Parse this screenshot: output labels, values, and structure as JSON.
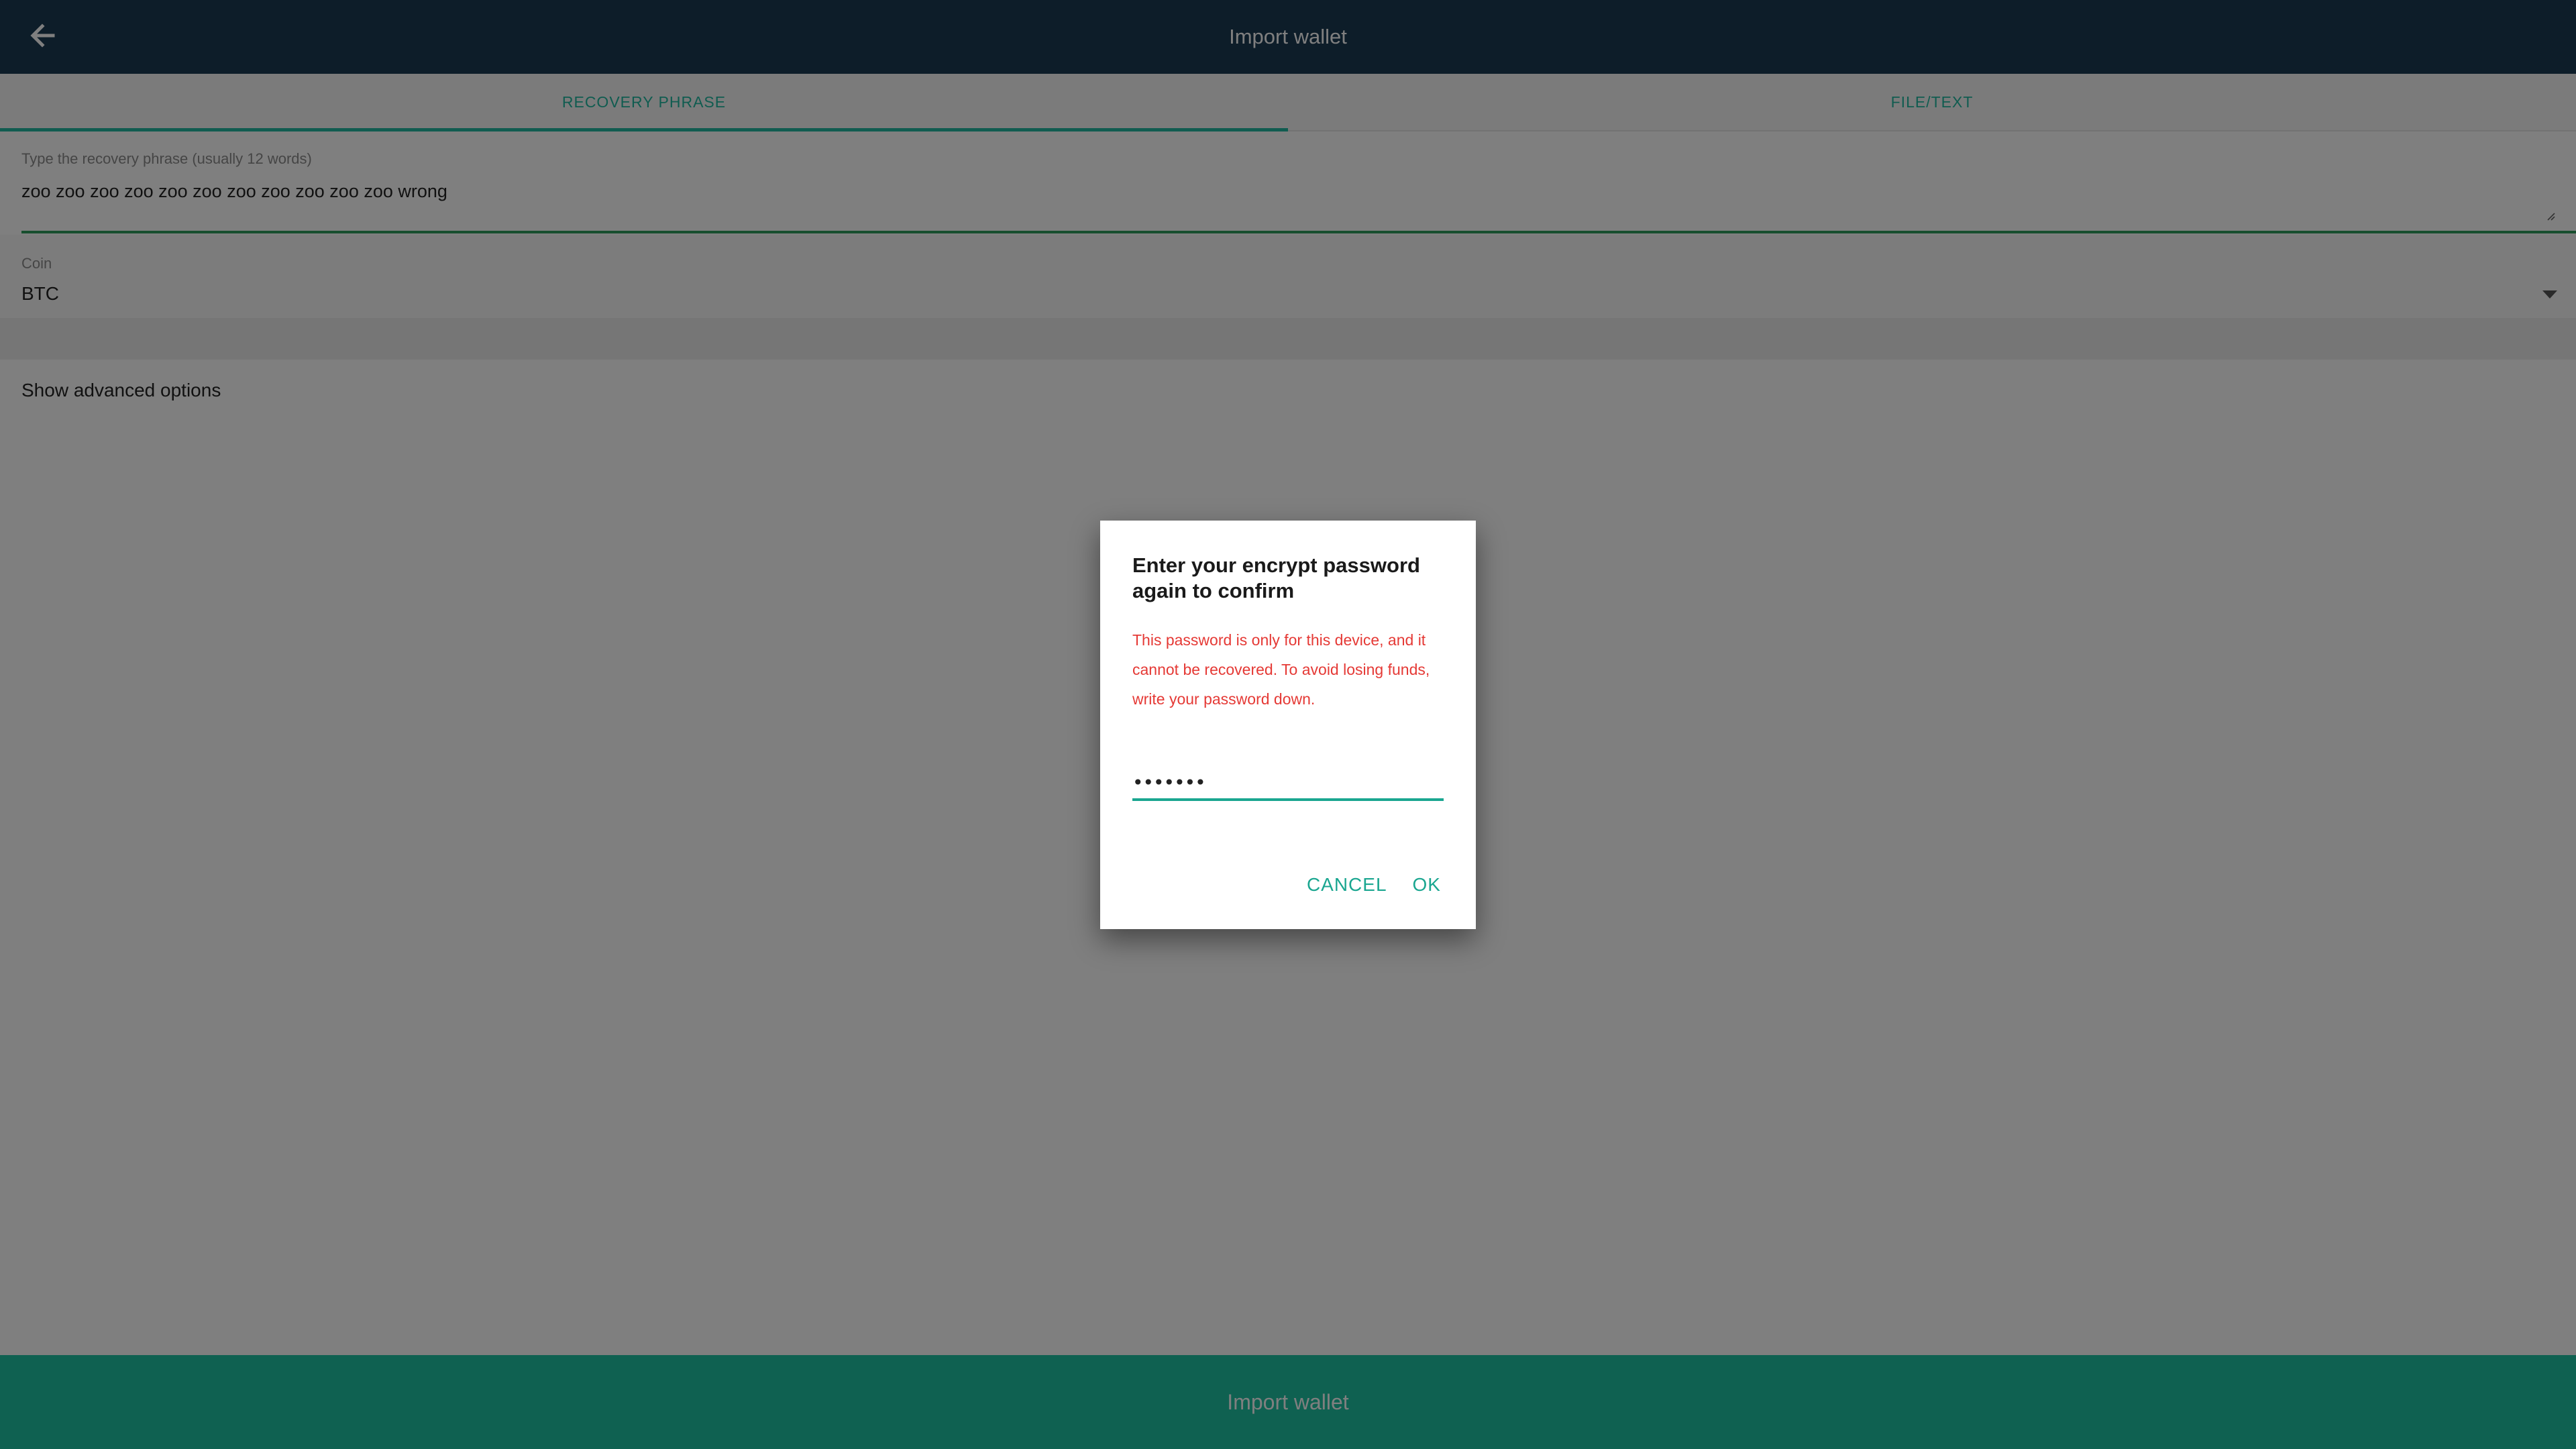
{
  "colors": {
    "appbar": "#1a3b52",
    "accent": "#21b8a0",
    "phrase_underline": "#2e9d5c",
    "warning_text": "#e53935",
    "bottom_bar": "#1ec3a2"
  },
  "appbar": {
    "title": "Import wallet",
    "back_icon": "arrow-left-icon"
  },
  "tabs": [
    {
      "label": "RECOVERY PHRASE",
      "active": true
    },
    {
      "label": "FILE/TEXT",
      "active": false
    }
  ],
  "phrase_field": {
    "label": "Type the recovery phrase (usually 12 words)",
    "value": "zoo zoo zoo zoo zoo zoo zoo zoo zoo zoo zoo wrong"
  },
  "coin_field": {
    "label": "Coin",
    "value": "BTC",
    "dropdown_icon": "caret-down-icon"
  },
  "advanced": {
    "label": "Show advanced options"
  },
  "bottom_bar": {
    "label": "Import wallet"
  },
  "dialog": {
    "title": "Enter your encrypt password again to confirm",
    "warning": "This password is only for this device, and it cannot be recovered. To avoid losing funds, write your password down.",
    "password_value": "•••••••",
    "cancel_label": "CANCEL",
    "ok_label": "OK"
  }
}
